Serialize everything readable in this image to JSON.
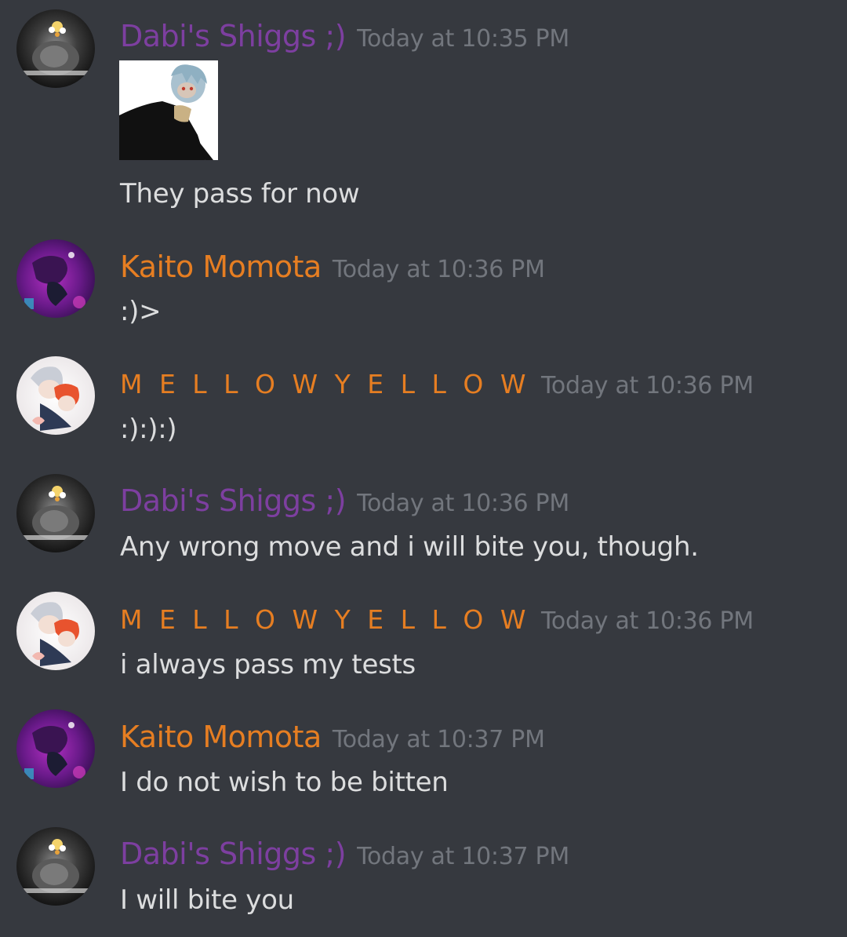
{
  "colors": {
    "background": "#36393f",
    "dabi_name": "#7d3fa0",
    "kaito_name": "#e67e22",
    "mellow_name": "#e67e22",
    "timestamp": "#72767d",
    "message_text": "#dcddde"
  },
  "messages": [
    {
      "author": "Dabi's Shiggs ;)",
      "timestamp": "Today at 10:35 PM",
      "attachment": "character-image",
      "text": "They pass for now"
    },
    {
      "author": "Kaito Momota",
      "timestamp": "Today at 10:36 PM",
      "text": ":)>"
    },
    {
      "author": "M E L L O W   Y E L L O W",
      "timestamp": "Today at 10:36 PM",
      "text": ":):):)"
    },
    {
      "author": "Dabi's Shiggs ;)",
      "timestamp": "Today at 10:36 PM",
      "text": "Any wrong move and i will bite you, though."
    },
    {
      "author": "M E L L O W   Y E L L O W",
      "timestamp": "Today at 10:36 PM",
      "text": "i always pass my tests"
    },
    {
      "author": "Kaito Momota",
      "timestamp": "Today at 10:37 PM",
      "text": "I do not wish to be bitten"
    },
    {
      "author": "Dabi's Shiggs ;)",
      "timestamp": "Today at 10:37 PM",
      "text": "I will bite you"
    }
  ]
}
